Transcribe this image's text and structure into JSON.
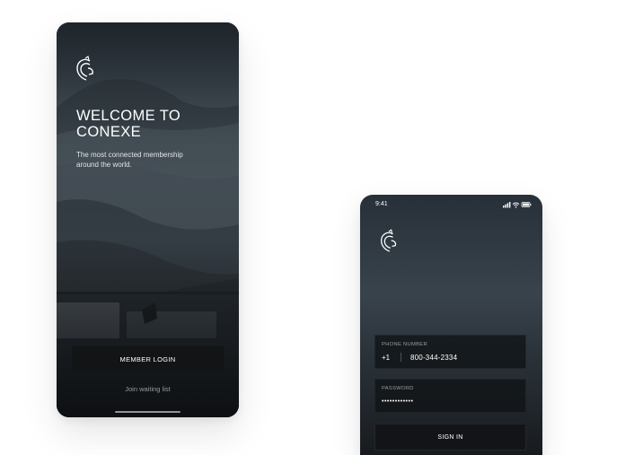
{
  "welcome_screen": {
    "logo_icon": "horse-head-logo-icon",
    "title": "WELCOME TO\nCONEXE",
    "subtitle": "The most connected membership around the world.",
    "login_button": "MEMBER LOGIN",
    "waiting_link": "Join waiting list"
  },
  "signin_screen": {
    "time": "9:41",
    "status_icons": [
      "signal-icon",
      "wifi-icon",
      "battery-icon"
    ],
    "logo_icon": "horse-head-logo-icon",
    "phone_field": {
      "label": "PHONE NUMBER",
      "country_code": "+1",
      "value": "800-344-2334"
    },
    "password_field": {
      "label": "PASSWORD",
      "value": "••••••••••••"
    },
    "signin_button": "SIGN IN"
  },
  "colors": {
    "page_background": "#ffffff",
    "button_dark": "#121416",
    "text_light": "#ffffff"
  }
}
